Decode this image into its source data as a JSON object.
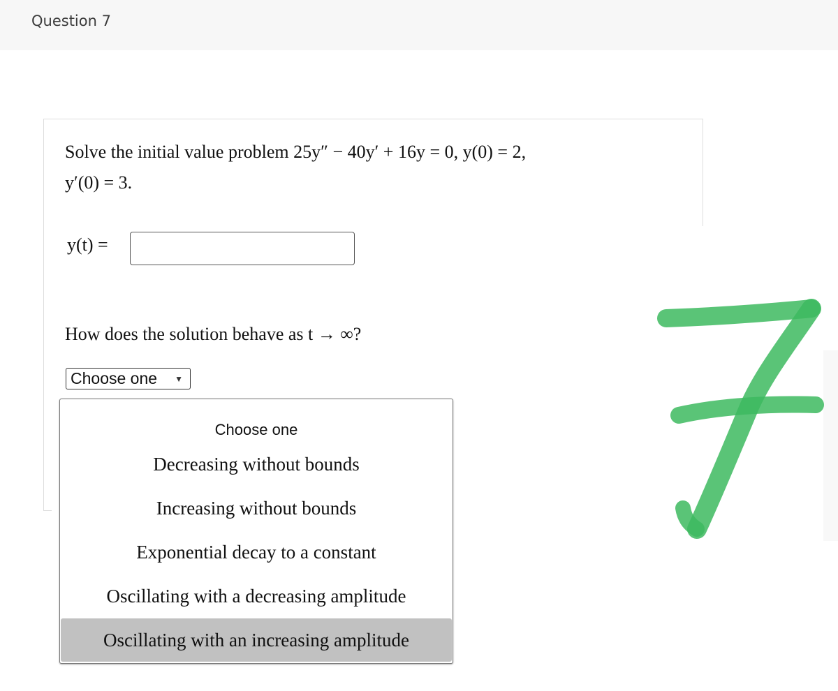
{
  "header": {
    "title": "Question 7"
  },
  "problem": {
    "intro": "Solve the initial value problem ",
    "equation": "25y″ − 40y′ + 16y = 0, y(0) = 2,",
    "initial_condition_2": "y′(0) = 3."
  },
  "answer": {
    "label": "y(t) =",
    "value": "",
    "placeholder": ""
  },
  "behavior_question": {
    "text": "How does the solution behave as t → ∞?"
  },
  "select": {
    "selected": "Choose one",
    "arrow_icon": "▼",
    "options": [
      "Choose one",
      "Decreasing without bounds",
      "Increasing without bounds",
      "Exponential decay to a constant",
      "Oscillating with a decreasing amplitude",
      "Oscillating with an increasing amplitude"
    ],
    "highlighted_index": 5
  },
  "annotation": {
    "glyph": "7",
    "color": "#3dba5f"
  }
}
